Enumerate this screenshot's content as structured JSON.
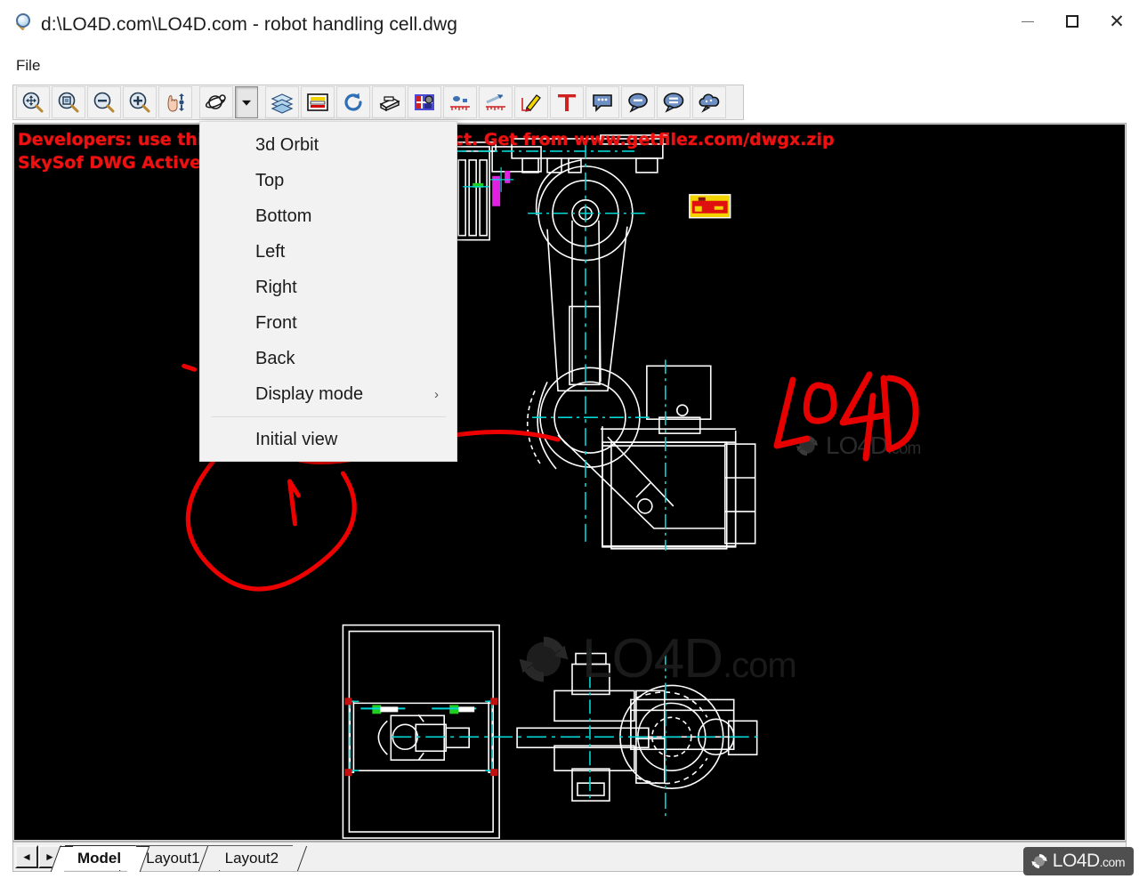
{
  "window": {
    "title": "d:\\LO4D.com\\LO4D.com - robot handling cell.dwg",
    "icon": "magnifier-icon",
    "controls": {
      "minimize": "–",
      "maximize": "□",
      "close": "✕"
    }
  },
  "menubar": {
    "items": [
      {
        "label": "File"
      }
    ]
  },
  "toolbar": {
    "buttons": [
      {
        "name": "zoom-realtime",
        "label": "Zoom realtime",
        "icon": "zoom-pan-icon"
      },
      {
        "name": "zoom-window",
        "label": "Zoom window",
        "icon": "zoom-window-icon"
      },
      {
        "name": "zoom-out",
        "label": "Zoom out",
        "icon": "zoom-out-icon"
      },
      {
        "name": "zoom-in",
        "label": "Zoom in",
        "icon": "zoom-in-icon"
      },
      {
        "name": "pan",
        "label": "Pan",
        "icon": "pan-hand-icon"
      },
      {
        "name": "orbit-3d",
        "label": "3d Orbit",
        "icon": "orbit-icon"
      },
      {
        "name": "orbit-dropdown",
        "label": "View menu",
        "icon": "chevron-down-icon"
      },
      {
        "name": "layers",
        "label": "Layers",
        "icon": "layers-icon"
      },
      {
        "name": "linetypes",
        "label": "Line types",
        "icon": "linetype-icon"
      },
      {
        "name": "regen",
        "label": "Regenerate",
        "icon": "refresh-icon"
      },
      {
        "name": "print",
        "label": "Print",
        "icon": "printer-icon"
      },
      {
        "name": "raster",
        "label": "Raster image",
        "icon": "image-icon"
      },
      {
        "name": "measure-area",
        "label": "Measure area",
        "icon": "measure-area-icon"
      },
      {
        "name": "measure-distance",
        "label": "Measure distance",
        "icon": "measure-distance-icon"
      },
      {
        "name": "markup-pen",
        "label": "Markup pen",
        "icon": "pencil-icon"
      },
      {
        "name": "text-tool",
        "label": "Text",
        "icon": "text-t-icon"
      },
      {
        "name": "note-1",
        "label": "Add note",
        "icon": "callout-square-icon"
      },
      {
        "name": "note-2",
        "label": "Add comment",
        "icon": "callout-round-icon"
      },
      {
        "name": "note-3",
        "label": "Add cloud note",
        "icon": "callout-cloud-icon"
      },
      {
        "name": "note-4",
        "label": "Revision cloud",
        "icon": "cloud-icon"
      }
    ]
  },
  "view_menu": {
    "items": [
      {
        "label": "3d Orbit",
        "submenu": false,
        "separator_after": false
      },
      {
        "label": "Top",
        "submenu": false,
        "separator_after": false
      },
      {
        "label": "Bottom",
        "submenu": false,
        "separator_after": false
      },
      {
        "label": "Left",
        "submenu": false,
        "separator_after": false
      },
      {
        "label": "Right",
        "submenu": false,
        "separator_after": false
      },
      {
        "label": "Front",
        "submenu": false,
        "separator_after": false
      },
      {
        "label": "Back",
        "submenu": false,
        "separator_after": false
      },
      {
        "label": "Display mode",
        "submenu": true,
        "separator_after": true
      },
      {
        "label": "Initial view",
        "submenu": false,
        "separator_after": false
      }
    ],
    "submenu_arrow": "›"
  },
  "canvas": {
    "background_color": "#000000",
    "nag_line1": "Developers: use this component in your project. Get from www.getfilez.com/dwgx.zip",
    "nag_line2": "SkySof DWG ActiveX control",
    "nag_color": "#ee1111",
    "line_color": "#ffffff",
    "centerline_color": "#00d7d7",
    "markup_color": "#ee0000",
    "handwriting": "LO4D"
  },
  "watermark": {
    "text_main": "LO4D",
    "text_suffix": ".com"
  },
  "tabstrip": {
    "nav_prev": "◄",
    "nav_next": "►",
    "tabs": [
      {
        "label": "Model",
        "active": true
      },
      {
        "label": "Layout1",
        "active": false
      },
      {
        "label": "Layout2",
        "active": false
      }
    ]
  },
  "badge": {
    "text_main": "LO4D",
    "text_suffix": ".com"
  }
}
